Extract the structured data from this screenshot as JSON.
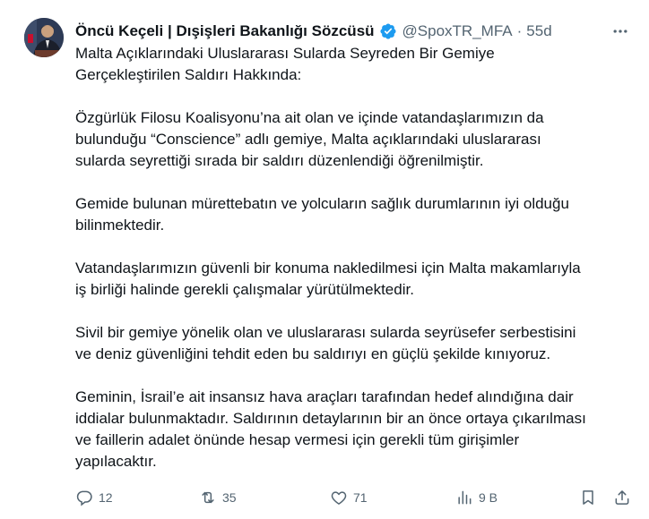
{
  "author": {
    "name": "Öncü Keçeli | Dışişleri Bakanlığı Sözcüsü",
    "handle": "@SpoxTR_MFA",
    "separator": "·",
    "time": "55d"
  },
  "tweet": {
    "paragraphs": [
      "Malta Açıklarındaki Uluslararası Sularda Seyreden Bir Gemiye\nGerçekleştirilen Saldırı Hakkında:",
      "Özgürlük Filosu Koalisyonu’na ait olan ve içinde vatandaşlarımızın da\nbulunduğu “Conscience” adlı gemiye, Malta açıklarındaki uluslararası\nsularda seyrettiği sırada bir saldırı düzenlendiği öğrenilmiştir.",
      "Gemide bulunan mürettebatın ve yolcuların sağlık durumlarının iyi olduğu\nbilinmektedir.",
      "Vatandaşlarımızın güvenli bir konuma nakledilmesi için Malta makamlarıyla\niş birliği halinde gerekli çalışmalar yürütülmektedir.",
      "Sivil bir gemiye yönelik olan ve uluslararası sularda seyrüsefer serbestisini\nve deniz güvenliğini tehdit eden bu saldırıyı en güçlü şekilde kınıyoruz.",
      "Geminin, İsrail’e ait insansız hava araçları tarafından hedef alındığına dair\niddialar bulunmaktadır. Saldırının detaylarının bir an önce ortaya çıkarılması\nve faillerin adalet önünde hesap vermesi için gerekli tüm girişimler\nyapılacaktır."
    ]
  },
  "actions": {
    "replies": "12",
    "reposts": "35",
    "likes": "71",
    "views": "9 B"
  },
  "colors": {
    "text": "#0f1419",
    "secondary": "#536471",
    "verified": "#1d9bf0"
  },
  "icons": [
    "reply-icon",
    "repost-icon",
    "like-icon",
    "views-icon",
    "bookmark-icon",
    "share-icon",
    "more-icon",
    "verified-icon"
  ]
}
